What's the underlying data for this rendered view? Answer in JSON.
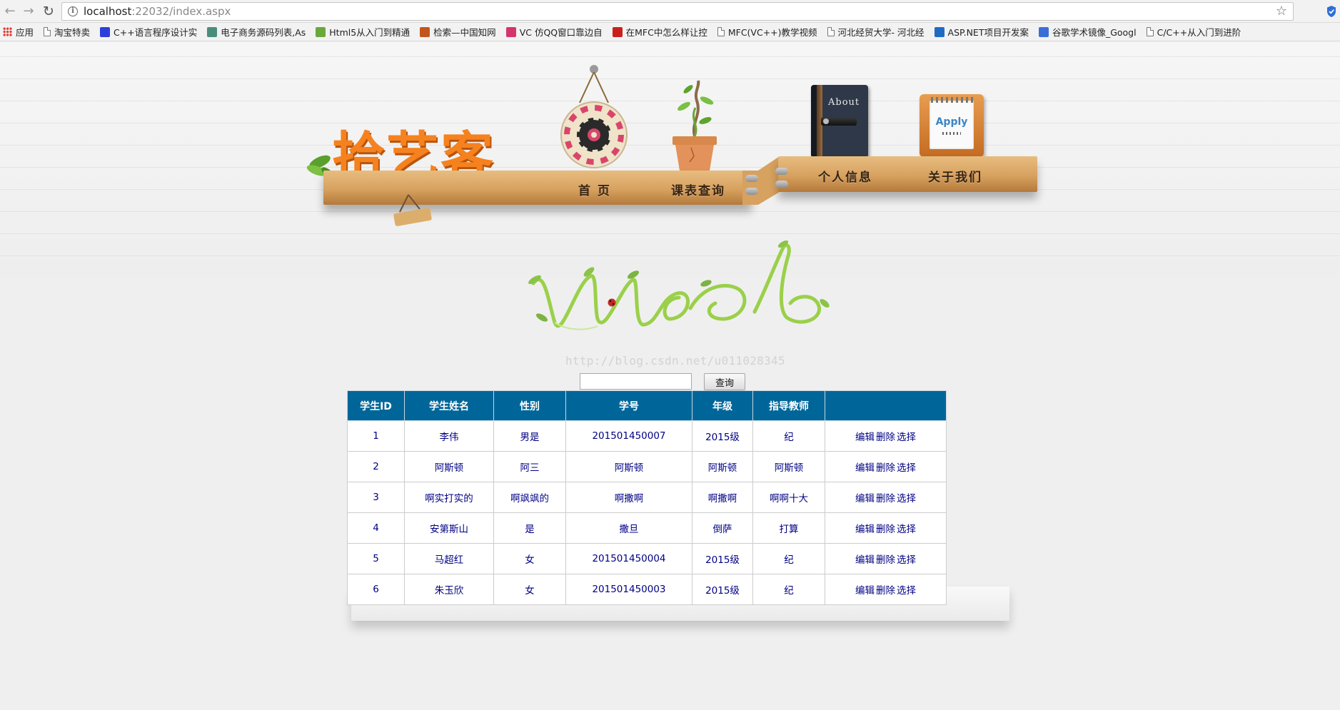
{
  "browser": {
    "url_host": "localhost",
    "url_rest": ":22032/index.aspx",
    "bookmarks": [
      {
        "label": "应用",
        "icon": "apps-grid-icon"
      },
      {
        "label": "淘宝特卖",
        "icon": "page-icon"
      },
      {
        "label": "C++语言程序设计实",
        "icon": "baidu-icon"
      },
      {
        "label": "电子商务源码列表,As",
        "icon": "code-icon"
      },
      {
        "label": "Html5从入门到精通",
        "icon": "ji-icon"
      },
      {
        "label": "检索—中国知网",
        "icon": "zhi-icon"
      },
      {
        "label": "VC 仿QQ窗口靠边自",
        "icon": "xin-icon"
      },
      {
        "label": "在MFC中怎么样让控",
        "icon": "csdn-icon"
      },
      {
        "label": "MFC(VC++)教学视频",
        "icon": "page-icon"
      },
      {
        "label": "河北经贸大学- 河北经",
        "icon": "page-icon"
      },
      {
        "label": "ASP.NET项目开发案",
        "icon": "aspnet-icon"
      },
      {
        "label": "谷歌学术镜像_Googl",
        "icon": "scholar-icon"
      },
      {
        "label": "C/C++从入门到进阶",
        "icon": "page-icon"
      }
    ]
  },
  "site": {
    "brand": "拾艺客",
    "nav": {
      "home": "首 页",
      "schedule": "课表查询",
      "profile": "个人信息",
      "about": "关于我们"
    },
    "book_label": "About",
    "apply_label": "Apply",
    "watermark": "http://blog.csdn.net/u011028345"
  },
  "search": {
    "value": "",
    "button_label": "查询"
  },
  "table": {
    "headers": [
      "学生ID",
      "学生姓名",
      "性别",
      "学号",
      "年级",
      "指导教师",
      ""
    ],
    "rows": [
      {
        "id": "1",
        "name": "李伟",
        "gender": "男是",
        "sno": "201501450007",
        "grade": "2015级",
        "teacher": "纪"
      },
      {
        "id": "2",
        "name": "阿斯顿",
        "gender": "阿三",
        "sno": "阿斯顿",
        "grade": "阿斯顿",
        "teacher": "阿斯顿"
      },
      {
        "id": "3",
        "name": "啊实打实的",
        "gender": "啊飒飒的",
        "sno": "啊撒啊",
        "grade": "啊撒啊",
        "teacher": "啊啊十大"
      },
      {
        "id": "4",
        "name": "安第斯山",
        "gender": "是",
        "sno": "撒旦",
        "grade": "倒萨",
        "teacher": "打算"
      },
      {
        "id": "5",
        "name": "马超红",
        "gender": "女",
        "sno": "201501450004",
        "grade": "2015级",
        "teacher": "纪"
      },
      {
        "id": "6",
        "name": "朱玉欣",
        "gender": "女",
        "sno": "201501450003",
        "grade": "2015级",
        "teacher": "纪"
      }
    ],
    "actions": {
      "edit": "编辑",
      "delete": "删除",
      "select": "选择"
    }
  },
  "colors": {
    "header_bg": "#006699",
    "cell_text": "#000084",
    "brand_orange": "#f5821f"
  }
}
